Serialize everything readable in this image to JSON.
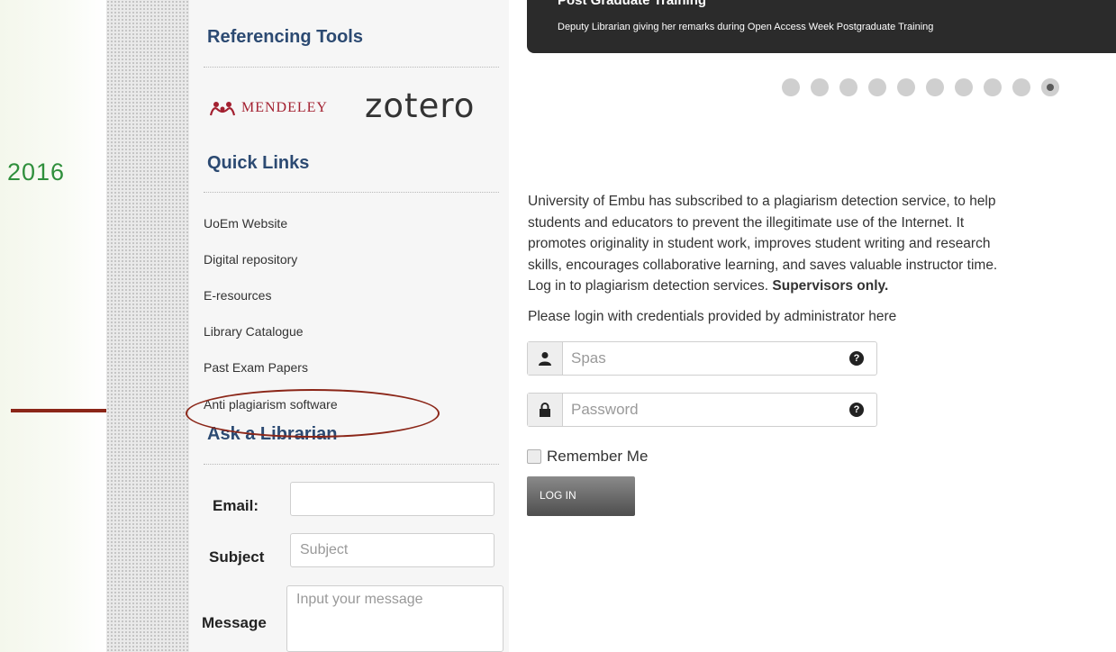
{
  "slide": {
    "year_text": "2016"
  },
  "sidebar": {
    "referencing_title": "Referencing Tools",
    "mendeley_label": "MENDELEY",
    "zotero_label": "zotero",
    "quick_links_title": "Quick Links",
    "quick_links": [
      "UoEm Website",
      "Digital repository",
      "E-resources",
      "Library Catalogue",
      "Past Exam Papers",
      "Anti plagiarism software"
    ],
    "ask_title": "Ask a Librarian",
    "form": {
      "email_label": "Email:",
      "email_value": "",
      "subject_label": "Subject",
      "subject_placeholder": "Subject",
      "message_label": "Message",
      "message_placeholder": "Input your message"
    }
  },
  "banner": {
    "title": "Post Graduate Training",
    "caption": "Deputy Librarian giving her remarks during Open Access Week Postgraduate Training",
    "dot_count": 10,
    "active_dot": 10
  },
  "main": {
    "para_lines": [
      "University of Embu has subscribed to a plagiarism detection service, to help",
      "students and educators to prevent the illegitimate use of the Internet. It",
      "promotes originality in student work, improves student writing and research",
      "skills, encourages collaborative learning, and saves valuable instructor time."
    ],
    "login_prefix": "Log in to plagiarism detection services. ",
    "login_bold": "Supervisors only.",
    "login_note": "Please login with credentials provided by administrator here",
    "username_placeholder": "Spas",
    "password_placeholder": "Password",
    "help_glyph": "?",
    "remember_label": "Remember Me",
    "login_button": "LOG IN"
  },
  "colors": {
    "heading": "#2c4a72",
    "annotation": "#8b2618",
    "year": "#2f8f3c"
  }
}
